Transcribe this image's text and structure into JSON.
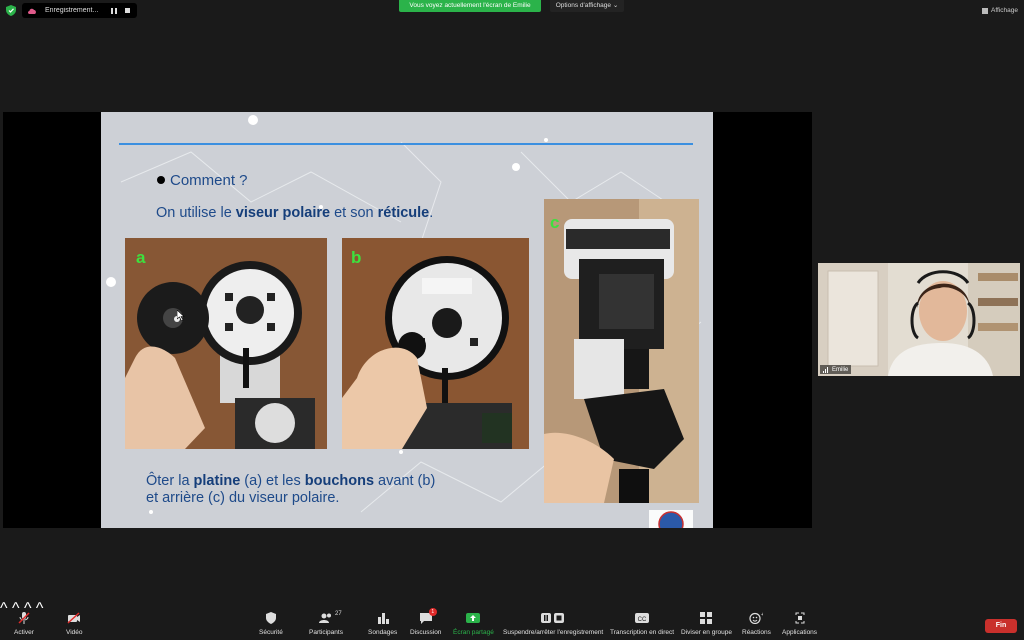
{
  "top_bar": {
    "recording_label": "Enregistrement...",
    "share_banner": "Vous voyez actuellement l'écran de Emilie",
    "view_options": "Options d'affichage",
    "view_button": "Affichage"
  },
  "slide": {
    "question": "Comment ?",
    "line1_prefix": "On utilise le ",
    "line1_bold1": "viseur polaire",
    "line1_mid": " et son ",
    "line1_bold2": "réticule",
    "line1_end": ".",
    "photos": [
      {
        "tag": "a"
      },
      {
        "tag": "b"
      },
      {
        "tag": "c"
      }
    ],
    "footer_p1": "Ôter la ",
    "footer_b1": "platine",
    "footer_p2": " (a) et les ",
    "footer_b2": "bouchons",
    "footer_p3": " avant (b)",
    "footer_line2": "et arrière (c) du viseur polaire."
  },
  "participant": {
    "name": "Emilie"
  },
  "toolbar": {
    "items": [
      {
        "label": "Activer"
      },
      {
        "label": "Vidéo"
      },
      {
        "label": "Sécurité"
      },
      {
        "label": "Participants",
        "count": "27"
      },
      {
        "label": "Sondages"
      },
      {
        "label": "Discussion",
        "badge": "1"
      },
      {
        "label": "Écran partagé"
      },
      {
        "label": "Suspendre/arrêter l'enregistrement"
      },
      {
        "label": "Transcription en direct"
      },
      {
        "label": "Diviser en groupe"
      },
      {
        "label": "Réactions"
      },
      {
        "label": "Applications"
      }
    ],
    "end_label": "Fin"
  },
  "colors": {
    "share_green": "#2bb34a",
    "end_red": "#c9302c",
    "slide_blue": "#1e4a8a",
    "rule_blue": "#3b8fe0"
  }
}
